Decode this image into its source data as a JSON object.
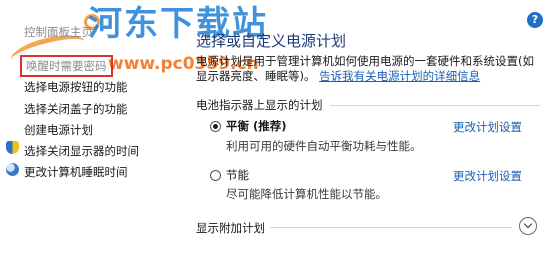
{
  "watermark": {
    "brand": "河东下载站",
    "url": "www.pc0359.cn"
  },
  "help": {
    "label": "?"
  },
  "sidebar": {
    "items": [
      {
        "label": "控制面板主页"
      },
      {
        "label": "唤醒时需要密码"
      },
      {
        "label": "选择电源按钮的功能"
      },
      {
        "label": "选择关闭盖子的功能"
      },
      {
        "label": "创建电源计划"
      },
      {
        "label": "选择关闭显示器的时间"
      },
      {
        "label": "更改计算机睡眠时间"
      }
    ]
  },
  "main": {
    "title": "选择或自定义电源计划",
    "description": "电源计划是用于管理计算机如何使用电源的一套硬件和系统设置(如显示器亮度、睡眠等)。",
    "description_link": "告诉我有关电源计划的详细信息",
    "battery_section": "电池指示器上显示的计划",
    "plans": [
      {
        "name": "平衡 (推荐)",
        "desc": "利用可用的硬件自动平衡功耗与性能。",
        "link": "更改计划设置",
        "selected": true
      },
      {
        "name": "节能",
        "desc": "尽可能降低计算机性能以节能。",
        "link": "更改计划设置",
        "selected": false
      }
    ],
    "additional_section": "显示附加计划"
  }
}
